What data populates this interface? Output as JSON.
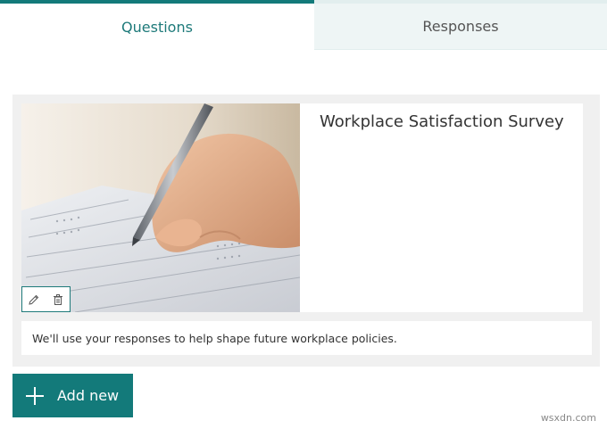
{
  "tabs": [
    {
      "label": "Questions",
      "active": true
    },
    {
      "label": "Responses",
      "active": false
    }
  ],
  "form": {
    "title": "Workplace Satisfaction Survey",
    "description": "We'll use your responses to help shape future workplace policies.",
    "header_image": "photo-hand-writing-on-survey-form"
  },
  "image_tools": {
    "edit_icon": "pencil-icon",
    "delete_icon": "trash-icon"
  },
  "add_new": {
    "label": "Add new",
    "icon": "plus-icon"
  },
  "watermark": "wsxdn.com",
  "colors": {
    "accent": "#137a7a",
    "tab_inactive_bg": "#eef5f5",
    "card_bg": "#f0f0f0"
  }
}
